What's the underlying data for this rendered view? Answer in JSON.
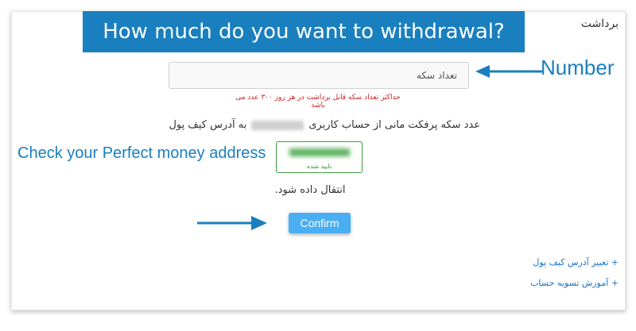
{
  "page": {
    "title": "برداشت",
    "banner": "How much do you want to withdrawal?"
  },
  "form": {
    "quantity_placeholder": "تعداد سکه",
    "max_hint": "حداکثر تعداد سکه قابل برداشت در هر روز ۳۰۰ عدد می باشد",
    "transfer_prefix": "عدد سکه پرفکت مانی از حساب کاربری",
    "transfer_suffix": "به آدرس کیف پول",
    "wallet_status": "تایید شده",
    "transfer_end": "انتقال داده شود.",
    "confirm_label": "Confirm"
  },
  "annotations": {
    "number": "Number",
    "check_address": "Check your Perfect money address"
  },
  "links": {
    "change_wallet": "+ تغییر آدرس کیف پول",
    "settlement_tutorial": "+ آموزش تسویه حساب"
  },
  "colors": {
    "accent": "#1a7fbf",
    "button": "#4aaef2",
    "error": "#cc2020",
    "verified": "#3c9a3c"
  }
}
